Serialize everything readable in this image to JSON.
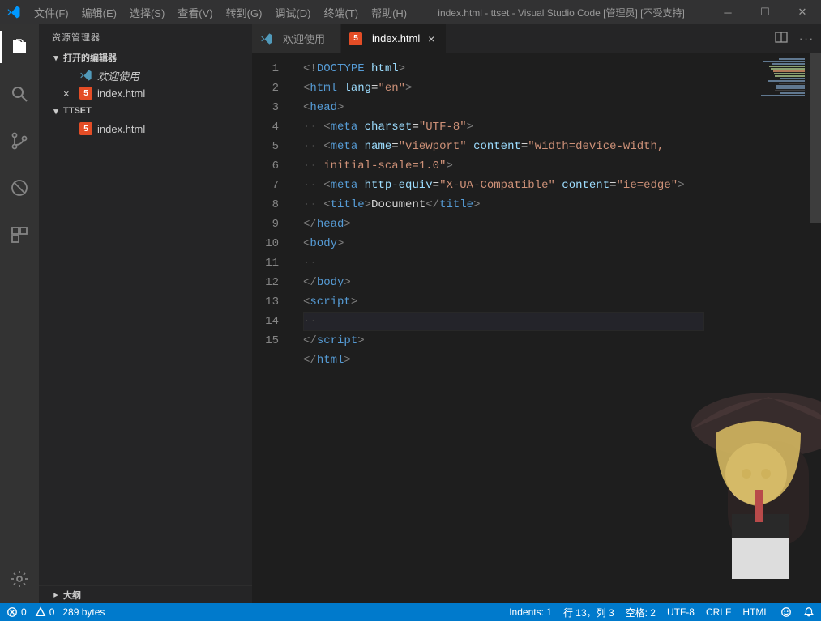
{
  "titlebar": {
    "menus": [
      "文件(F)",
      "编辑(E)",
      "选择(S)",
      "查看(V)",
      "转到(G)",
      "调试(D)",
      "终端(T)",
      "帮助(H)"
    ],
    "title": "index.html - ttset - Visual Studio Code [管理员] [不受支持]"
  },
  "sidebar": {
    "header": "资源管理器",
    "sections": {
      "openEditors": {
        "label": "打开的编辑器"
      },
      "project": {
        "label": "TTSET"
      }
    },
    "openEditors": [
      {
        "label": "欢迎使用",
        "kind": "welcome",
        "italic": true,
        "closeable": false
      },
      {
        "label": "index.html",
        "kind": "html",
        "italic": false,
        "closeable": true
      }
    ],
    "projectFiles": [
      {
        "label": "index.html",
        "kind": "html"
      }
    ],
    "outline": "大纲"
  },
  "tabs": [
    {
      "label": "欢迎使用",
      "kind": "welcome",
      "active": false
    },
    {
      "label": "index.html",
      "kind": "html",
      "active": true
    }
  ],
  "code": {
    "lines": [
      [
        {
          "t": "bracket",
          "v": "<!"
        },
        {
          "t": "doctype",
          "v": "DOCTYPE "
        },
        {
          "t": "attr",
          "v": "html"
        },
        {
          "t": "bracket",
          "v": ">"
        }
      ],
      [
        {
          "t": "bracket",
          "v": "<"
        },
        {
          "t": "tag",
          "v": "html "
        },
        {
          "t": "attr",
          "v": "lang"
        },
        {
          "t": "text",
          "v": "="
        },
        {
          "t": "string",
          "v": "\"en\""
        },
        {
          "t": "bracket",
          "v": ">"
        }
      ],
      [
        {
          "t": "bracket",
          "v": "<"
        },
        {
          "t": "tag",
          "v": "head"
        },
        {
          "t": "bracket",
          "v": ">"
        }
      ],
      [
        {
          "t": "guide",
          "v": "·· "
        },
        {
          "t": "bracket",
          "v": "<"
        },
        {
          "t": "tag",
          "v": "meta "
        },
        {
          "t": "attr",
          "v": "charset"
        },
        {
          "t": "text",
          "v": "="
        },
        {
          "t": "string",
          "v": "\"UTF-8\""
        },
        {
          "t": "bracket",
          "v": ">"
        }
      ],
      [
        {
          "t": "guide",
          "v": "·· "
        },
        {
          "t": "bracket",
          "v": "<"
        },
        {
          "t": "tag",
          "v": "meta "
        },
        {
          "t": "attr",
          "v": "name"
        },
        {
          "t": "text",
          "v": "="
        },
        {
          "t": "string",
          "v": "\"viewport\" "
        },
        {
          "t": "attr",
          "v": "content"
        },
        {
          "t": "text",
          "v": "="
        },
        {
          "t": "string",
          "v": "\"width=device-width, "
        }
      ],
      [
        {
          "t": "guide",
          "v": "·· "
        },
        {
          "t": "string",
          "v": "initial-scale=1.0\""
        },
        {
          "t": "bracket",
          "v": ">"
        }
      ],
      [
        {
          "t": "guide",
          "v": "·· "
        },
        {
          "t": "bracket",
          "v": "<"
        },
        {
          "t": "tag",
          "v": "meta "
        },
        {
          "t": "attr",
          "v": "http-equiv"
        },
        {
          "t": "text",
          "v": "="
        },
        {
          "t": "string",
          "v": "\"X-UA-Compatible\" "
        },
        {
          "t": "attr",
          "v": "content"
        },
        {
          "t": "text",
          "v": "="
        },
        {
          "t": "string",
          "v": "\"ie=edge\""
        },
        {
          "t": "bracket",
          "v": ">"
        }
      ],
      [
        {
          "t": "guide",
          "v": "·· "
        },
        {
          "t": "bracket",
          "v": "<"
        },
        {
          "t": "tag",
          "v": "title"
        },
        {
          "t": "bracket",
          "v": ">"
        },
        {
          "t": "text",
          "v": "Document"
        },
        {
          "t": "bracket",
          "v": "</"
        },
        {
          "t": "tag",
          "v": "title"
        },
        {
          "t": "bracket",
          "v": ">"
        }
      ],
      [
        {
          "t": "bracket",
          "v": "</"
        },
        {
          "t": "tag",
          "v": "head"
        },
        {
          "t": "bracket",
          "v": ">"
        }
      ],
      [
        {
          "t": "bracket",
          "v": "<"
        },
        {
          "t": "tag",
          "v": "body"
        },
        {
          "t": "bracket",
          "v": ">"
        }
      ],
      [
        {
          "t": "guide",
          "v": "··"
        }
      ],
      [
        {
          "t": "bracket",
          "v": "</"
        },
        {
          "t": "tag",
          "v": "body"
        },
        {
          "t": "bracket",
          "v": ">"
        }
      ],
      [
        {
          "t": "bracket",
          "v": "<"
        },
        {
          "t": "tag",
          "v": "script"
        },
        {
          "t": "bracket",
          "v": ">"
        }
      ],
      [
        {
          "t": "guide",
          "v": "·· "
        }
      ],
      [
        {
          "t": "bracket",
          "v": "</"
        },
        {
          "t": "tag",
          "v": "script"
        },
        {
          "t": "bracket",
          "v": ">"
        }
      ],
      [
        {
          "t": "bracket",
          "v": "</"
        },
        {
          "t": "tag",
          "v": "html"
        },
        {
          "t": "bracket",
          "v": ">"
        }
      ]
    ],
    "lineNumbers": [
      "1",
      "2",
      "3",
      "4",
      "5",
      " ",
      "6",
      "7",
      "8",
      "9",
      "10",
      "11",
      "12",
      "13",
      "14",
      "15"
    ],
    "currentLineIndex": 13
  },
  "statusbar": {
    "errors": "0",
    "warnings": "0",
    "size": "289 bytes",
    "indents": "Indents: 1",
    "cursor": "行 13，列 3",
    "spaces": "空格: 2",
    "encoding": "UTF-8",
    "eol": "CRLF",
    "lang": "HTML"
  }
}
